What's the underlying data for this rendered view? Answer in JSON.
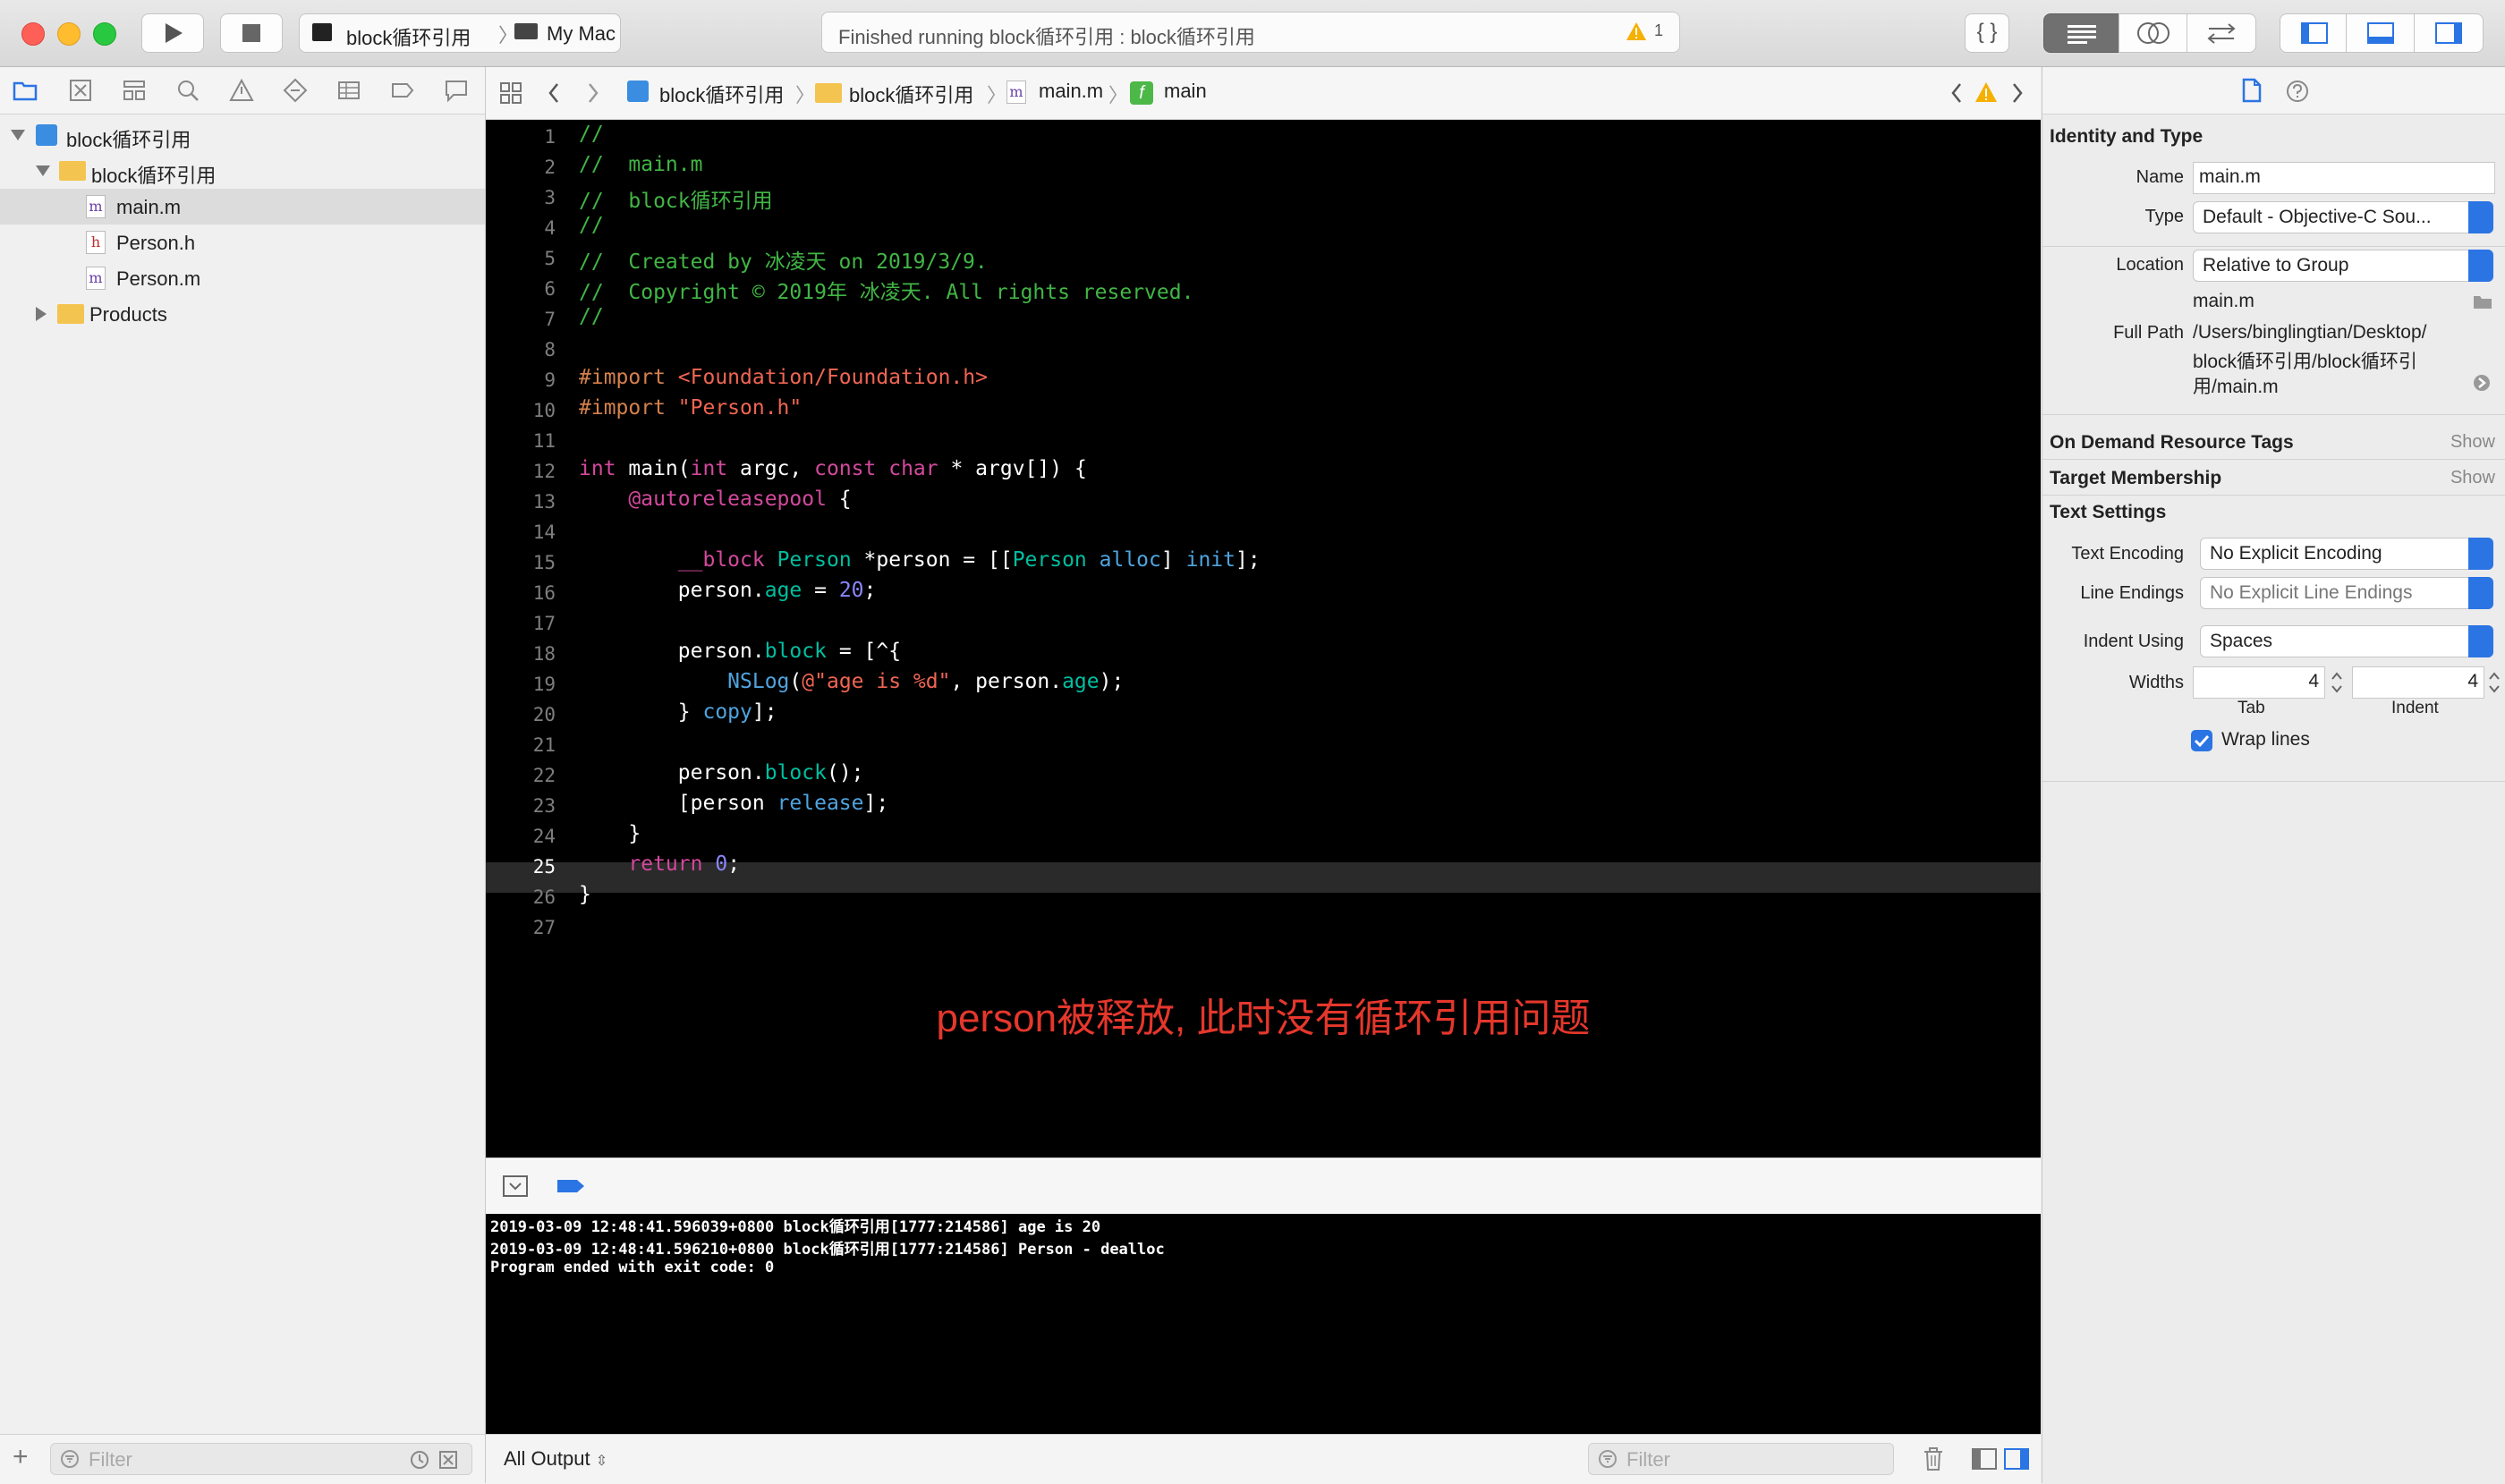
{
  "toolbar": {
    "scheme_target": "block循环引用",
    "scheme_device": "My Mac",
    "status_text": "Finished running block循环引用 : block循环引用",
    "warning_count": "1",
    "braces_label": "{ }"
  },
  "navigator": {
    "items": [
      {
        "label": "block循环引用",
        "kind": "project"
      },
      {
        "label": "block循环引用",
        "kind": "group"
      },
      {
        "label": "main.m",
        "kind": "m-file"
      },
      {
        "label": "Person.h",
        "kind": "h-file"
      },
      {
        "label": "Person.m",
        "kind": "m-file"
      },
      {
        "label": "Products",
        "kind": "group"
      }
    ],
    "file_letter_m": "m",
    "file_letter_h": "h",
    "filter_placeholder": "Filter"
  },
  "jumpbar": {
    "crumbs": [
      "block循环引用",
      "block循环引用",
      "main.m",
      "main"
    ],
    "file_letter": "m",
    "func_letter": "f"
  },
  "editor": {
    "line_numbers": [
      "1",
      "2",
      "3",
      "4",
      "5",
      "6",
      "7",
      "8",
      "9",
      "10",
      "11",
      "12",
      "13",
      "14",
      "15",
      "16",
      "17",
      "18",
      "19",
      "20",
      "21",
      "22",
      "23",
      "24",
      "25",
      "26",
      "27"
    ],
    "current_line": 25,
    "annotation": "person被释放, 此时没有循环引用问题",
    "code": {
      "l1": "//",
      "l2": "//  main.m",
      "l3": "//  block循环引用",
      "l4": "//",
      "l5": "//  Created by 冰凌天 on 2019/3/9.",
      "l6": "//  Copyright © 2019年 冰凌天. All rights reserved.",
      "l7": "//",
      "l9a": "#import ",
      "l9b": "<Foundation/Foundation.h>",
      "l10a": "#import ",
      "l10b": "\"Person.h\"",
      "l12a": "int",
      "l12b": " main(",
      "l12c": "int",
      "l12d": " argc, ",
      "l12e": "const",
      "l12f": " ",
      "l12g": "char",
      "l12h": " * argv[]) {",
      "l13a": "    ",
      "l13b": "@autoreleasepool",
      "l13c": " {",
      "l15a": "        ",
      "l15b": "__block",
      "l15c": " ",
      "l15d": "Person",
      "l15e": " *person = [[",
      "l15f": "Person",
      "l15g": " ",
      "l15h": "alloc",
      "l15i": "] ",
      "l15j": "init",
      "l15k": "];",
      "l16a": "        person.",
      "l16b": "age",
      "l16c": " = ",
      "l16d": "20",
      "l16e": ";",
      "l18a": "        person.",
      "l18b": "block",
      "l18c": " = [^{",
      "l19a": "            ",
      "l19b": "NSLog",
      "l19c": "(",
      "l19d": "@\"age is %d\"",
      "l19e": ", person.",
      "l19f": "age",
      "l19g": ");",
      "l20a": "        } ",
      "l20b": "copy",
      "l20c": "];",
      "l22a": "        person.",
      "l22b": "block",
      "l22c": "();",
      "l23a": "        [person ",
      "l23b": "release",
      "l23c": "];",
      "l24": "    }",
      "l25a": "    ",
      "l25b": "return",
      "l25c": " ",
      "l25d": "0",
      "l25e": ";",
      "l26": "}"
    }
  },
  "console": {
    "lines": [
      "2019-03-09 12:48:41.596039+0800 block循环引用[1777:214586] age is 20",
      "2019-03-09 12:48:41.596210+0800 block循环引用[1777:214586] Person - dealloc",
      "Program ended with exit code: 0"
    ],
    "output_selector": "All Output",
    "filter_placeholder": "Filter"
  },
  "inspector": {
    "identity_title": "Identity and Type",
    "name_label": "Name",
    "name_value": "main.m",
    "type_label": "Type",
    "type_value": "Default - Objective-C Sou...",
    "location_label": "Location",
    "location_value": "Relative to Group",
    "location_file": "main.m",
    "full_path_label": "Full Path",
    "full_path_lines": [
      "/Users/binglingtian/Desktop/",
      "block循环引用/block循环引",
      "用/main.m"
    ],
    "on_demand_title": "On Demand Resource Tags",
    "target_title": "Target Membership",
    "show_label": "Show",
    "text_settings_title": "Text Settings",
    "text_encoding_label": "Text Encoding",
    "text_encoding_value": "No Explicit Encoding",
    "line_endings_label": "Line Endings",
    "line_endings_value": "No Explicit Line Endings",
    "indent_using_label": "Indent Using",
    "indent_using_value": "Spaces",
    "widths_label": "Widths",
    "tab_width": "4",
    "indent_width": "4",
    "tab_label": "Tab",
    "indent_label": "Indent",
    "wrap_lines_label": "Wrap lines",
    "wrap_lines_checked": true
  },
  "colors": {
    "accent": "#2b74e4",
    "comment": "#41b645",
    "keyword": "#d3499d",
    "annotation": "#e5372c"
  }
}
